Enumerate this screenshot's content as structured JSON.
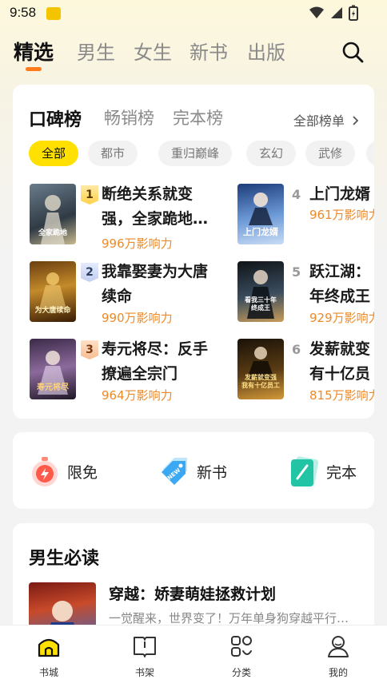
{
  "status_bar": {
    "time": "9:58"
  },
  "top_tabs": [
    "精选",
    "男生",
    "女生",
    "新书",
    "出版"
  ],
  "ranking": {
    "tabs": [
      "口碑榜",
      "畅销榜",
      "完本榜"
    ],
    "all_link": "全部榜单",
    "chips": [
      "全部",
      "都市",
      "重归巅峰",
      "玄幻",
      "武修",
      "复"
    ],
    "books": [
      {
        "rank": "1",
        "title_line1": "断绝关系就变",
        "title_line2": "强，全家跪地…",
        "hot": "996万影响力"
      },
      {
        "rank": "2",
        "title_line1": "我靠娶妻为大唐",
        "title_line2": "续命",
        "hot": "990万影响力"
      },
      {
        "rank": "3",
        "title_line1": "寿元将尽：反手",
        "title_line2": "撩遍全宗门",
        "hot": "964万影响力"
      },
      {
        "rank": "4",
        "title_line1": "上门龙婿",
        "title_line2": "",
        "hot": "961万影响力"
      },
      {
        "rank": "5",
        "title_line1": "跃江湖：",
        "title_line2": "年终成王",
        "hot": "929万影响力"
      },
      {
        "rank": "6",
        "title_line1": "发薪就变",
        "title_line2": "有十亿员",
        "hot": "815万影响力"
      }
    ],
    "cover_texts": {
      "c1": "全家跪地",
      "c2": "为大唐续命",
      "c3": "寿元将尽",
      "c4": "上门龙婿",
      "c5": "看我三十年 终成王",
      "c6": "发薪就变强 我有十亿员工"
    }
  },
  "quick_entries": [
    "限免",
    "新书",
    "完本"
  ],
  "must_read": {
    "title": "男生必读",
    "book_title": "穿越：娇妻萌娃拯救计划",
    "book_desc": "一觉醒来，世界变了！万年单身狗穿越平行…"
  },
  "bottom_nav": [
    "书城",
    "书架",
    "分类",
    "我的"
  ],
  "colors": {
    "accent": "#ffe000",
    "underline": "#ff7a1a",
    "hot": "#ec8a2a"
  }
}
